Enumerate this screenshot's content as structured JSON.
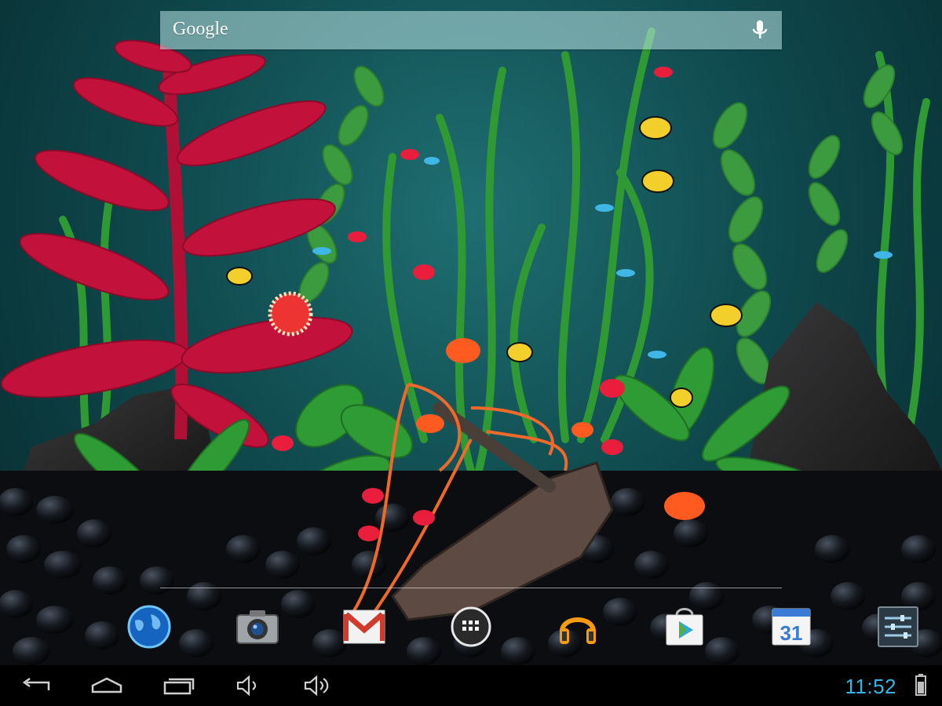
{
  "search": {
    "logo_text": "Google",
    "mic_icon": "mic-icon"
  },
  "dock": {
    "apps": [
      {
        "icon": "browser-globe-icon"
      },
      {
        "icon": "camera-icon"
      },
      {
        "icon": "gmail-icon"
      },
      {
        "icon": "app-drawer-icon"
      },
      {
        "icon": "play-music-headphones-icon"
      },
      {
        "icon": "play-store-icon"
      },
      {
        "icon": "calendar-icon",
        "label": "31"
      },
      {
        "icon": "settings-icon"
      }
    ]
  },
  "nav": {
    "buttons": [
      "back-icon",
      "home-icon",
      "recent-apps-icon",
      "volume-down-icon",
      "volume-up-icon"
    ]
  },
  "status": {
    "time": "11:52",
    "battery_icon": "battery-icon"
  },
  "colors": {
    "clock": "#33b5e5",
    "water": "#0f4a4e",
    "red_plant": "#c2123c",
    "green_plant": "#2f9a34"
  }
}
